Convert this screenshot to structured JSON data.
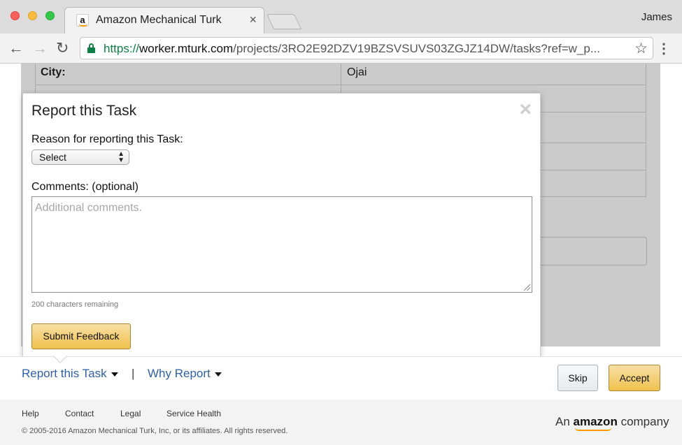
{
  "browser": {
    "tab_title": "Amazon Mechanical Turk",
    "tab_close": "×",
    "profile_name": "James",
    "url": {
      "scheme": "https://",
      "host": "worker.mturk.com",
      "path": "/projects/3RO2E92DZV19BZSVSUVS03ZGJZ14DW/tasks?ref=w_p..."
    },
    "icons": {
      "back": "back-arrow-icon",
      "forward": "forward-arrow-icon",
      "reload": "reload-icon",
      "bookmark": "star-icon",
      "menu": "more-vert-icon",
      "lock": "lock-icon"
    }
  },
  "task_table": {
    "rows": [
      {
        "label": "City:",
        "value": "Ojai"
      },
      {
        "label": "",
        "value": ""
      },
      {
        "label": "",
        "value": ""
      },
      {
        "label": "",
        "value": ""
      },
      {
        "label": "",
        "value": ""
      }
    ]
  },
  "modal": {
    "title": "Report this Task",
    "close": "×",
    "reason_label": "Reason for reporting this Task:",
    "reason_selected": "Select",
    "comments_label": "Comments: (optional)",
    "comments_placeholder": "Additional comments.",
    "chars_remaining": "200 characters remaining",
    "submit_label": "Submit Feedback"
  },
  "actions": {
    "report_link": "Report this Task",
    "separator": "|",
    "why_link": "Why Report",
    "skip_label": "Skip",
    "accept_label": "Accept"
  },
  "footer": {
    "links": [
      "Help",
      "Contact",
      "Legal",
      "Service Health"
    ],
    "copyright": "© 2005-2016 Amazon Mechanical Turk, Inc, or its affiliates. All rights reserved.",
    "brand_prefix": "An",
    "brand_name": "amazon",
    "brand_suffix": "company"
  },
  "colors": {
    "link": "#2e5fa8",
    "accent_button": "#f0c14b",
    "secure_green": "#0b8043",
    "overlay": "#cbcbcb"
  }
}
